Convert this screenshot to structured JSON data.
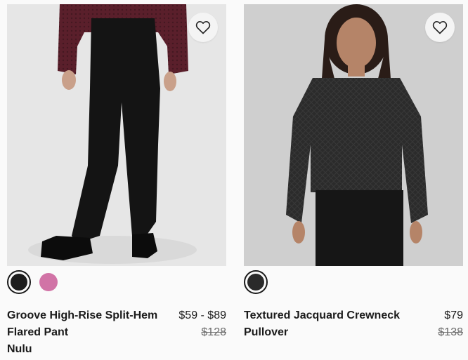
{
  "products": [
    {
      "name_line1": "Groove High-Rise Split-Hem",
      "name_line2": "Flared Pant",
      "name_line3": "Nulu",
      "price": "$59 - $89",
      "original_price": "$128",
      "swatches": [
        {
          "color": "#1c1c1c",
          "selected": true
        },
        {
          "color": "#d173a6",
          "selected": false
        }
      ]
    },
    {
      "name_line1": "Textured Jacquard Crewneck",
      "name_line2": "Pullover",
      "price": "$79",
      "original_price": "$138",
      "swatches": [
        {
          "color": "#2a2a2a",
          "selected": true
        }
      ]
    }
  ],
  "icons": {
    "wishlist": "heart-outline-icon"
  }
}
